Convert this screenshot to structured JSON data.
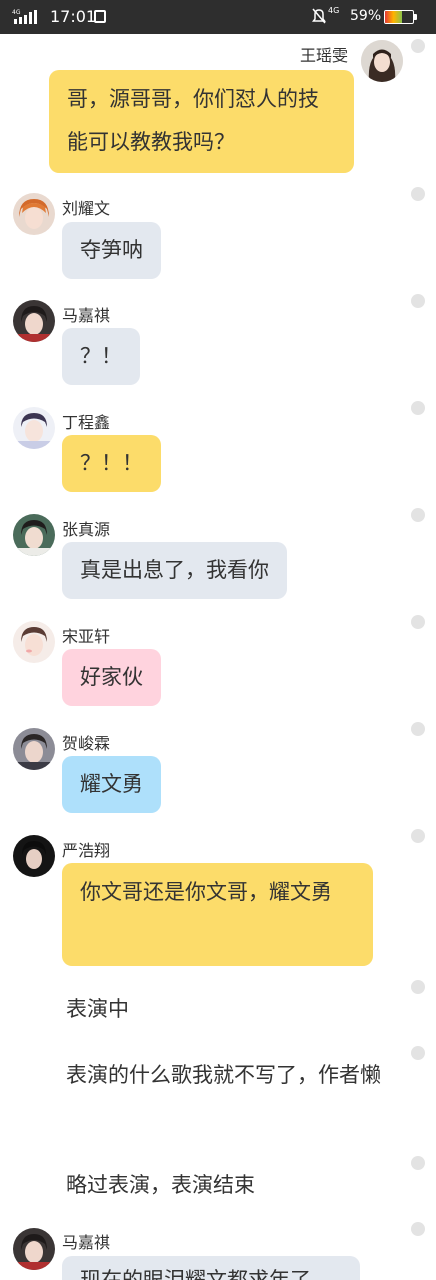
{
  "status_bar": {
    "network": "4G",
    "time": "17:01",
    "network_right": "4G",
    "battery_text": "59%",
    "battery_level": 0.59
  },
  "messages": [
    {
      "name": "王瑶雯",
      "text": "哥，源哥哥，你们怼人的技能可以教教我吗？"
    },
    {
      "name": "刘耀文",
      "text": "夺笋呐"
    },
    {
      "name": "马嘉祺",
      "text": "？！"
    },
    {
      "name": "丁程鑫",
      "text": "？！！"
    },
    {
      "name": "张真源",
      "text": "真是出息了，我看你"
    },
    {
      "name": "宋亚轩",
      "text": "好家伙"
    },
    {
      "name": "贺峻霖",
      "text": "耀文勇"
    },
    {
      "name": "严浩翔",
      "text": "你文哥还是你文哥，耀文勇"
    },
    {
      "name": "马嘉祺",
      "text": "现在的眼泪耀文都求年了"
    }
  ],
  "narration": [
    "表演中",
    "表演的什么歌我就不写了，作者懒",
    "略过表演，表演结束"
  ],
  "colors": {
    "status_bar_bg": "#2e2e2e",
    "bubble_grey": "#e3e8ef",
    "bubble_yellow": "#fcdc6a",
    "bubble_pink": "#ffd3de",
    "bubble_blue": "#aee0fb"
  }
}
